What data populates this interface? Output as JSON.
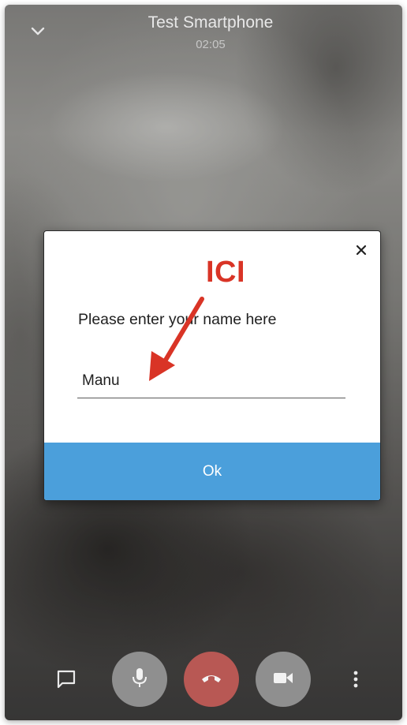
{
  "call": {
    "contact_name": "Test Smartphone",
    "duration": "02:05"
  },
  "dialog": {
    "message": "Please enter your name here",
    "input_value": "Manu",
    "ok_label": "Ok",
    "close_icon": "close-icon"
  },
  "annotation": {
    "label": "ICI",
    "color": "#d93426"
  },
  "controls": [
    {
      "name": "chat",
      "icon": "chat-bubble-icon"
    },
    {
      "name": "microphone",
      "icon": "microphone-icon"
    },
    {
      "name": "hang-up",
      "icon": "phone-hangup-icon"
    },
    {
      "name": "camera",
      "icon": "video-camera-icon"
    },
    {
      "name": "more",
      "icon": "more-vertical-icon"
    }
  ],
  "colors": {
    "ok_button": "#4b9fdb",
    "hangup_button": "#b85854",
    "control_button": "#8f8f8f"
  }
}
